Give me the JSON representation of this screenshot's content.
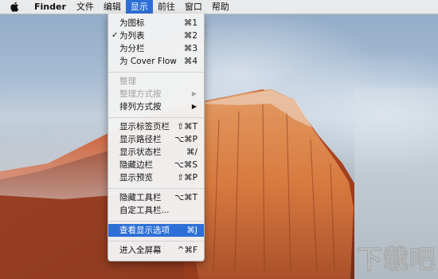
{
  "menubar": {
    "apple_icon": "apple-logo-icon",
    "app_name": "Finder",
    "menus": [
      "文件",
      "编辑",
      "显示",
      "前往",
      "窗口",
      "帮助"
    ],
    "active_menu": "显示"
  },
  "dropdown": {
    "items": [
      {
        "label": "为图标",
        "shortcut": "⌘1"
      },
      {
        "label": "为列表",
        "shortcut": "⌘2",
        "checked": true
      },
      {
        "label": "为分栏",
        "shortcut": "⌘3"
      },
      {
        "label": "为 Cover Flow",
        "shortcut": "⌘4"
      },
      {
        "label": "整理",
        "disabled": true
      },
      {
        "label": "整理方式按",
        "disabled": true,
        "submenu": true
      },
      {
        "label": "排列方式按",
        "submenu": true
      },
      {
        "label": "显示标签页栏",
        "shortcut": "⇧⌘T"
      },
      {
        "label": "显示路径栏",
        "shortcut": "⌥⌘P"
      },
      {
        "label": "显示状态栏",
        "shortcut": "⌘/"
      },
      {
        "label": "隐藏边栏",
        "shortcut": "⌥⌘S"
      },
      {
        "label": "显示预览",
        "shortcut": "⇧⌘P"
      },
      {
        "label": "隐藏工具栏",
        "shortcut": "⌥⌘T"
      },
      {
        "label": "自定工具栏..."
      },
      {
        "label": "查看显示选项",
        "shortcut": "⌘J",
        "highlighted": true
      },
      {
        "label": "进入全屏幕",
        "shortcut": "^⌘F"
      }
    ],
    "check_mark": "✓",
    "submenu_arrow": "▶"
  },
  "colors": {
    "highlight": "#2d6fd6",
    "disabled_text": "#a3a3a3"
  },
  "watermark": "下载吧"
}
